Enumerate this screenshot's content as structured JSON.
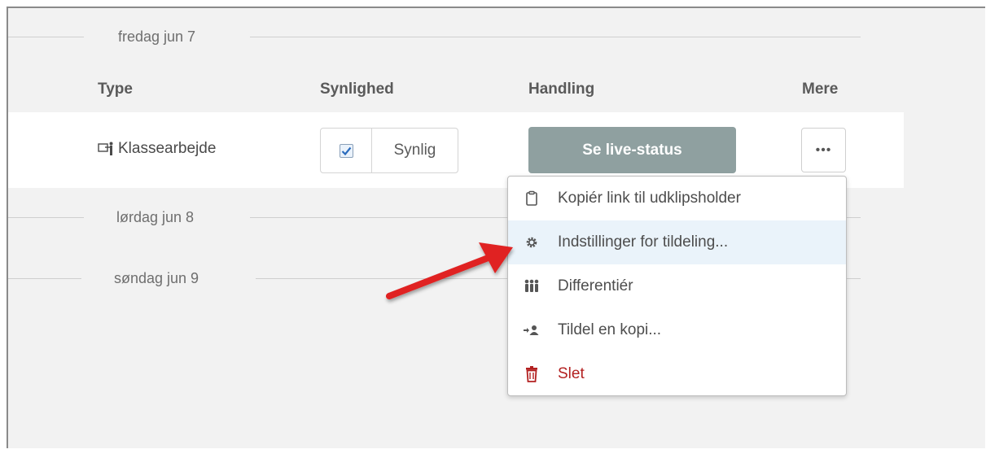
{
  "dates": {
    "friday": "fredag jun 7",
    "saturday": "lørdag jun 8",
    "sunday": "søndag jun 9"
  },
  "table": {
    "headers": {
      "type": "Type",
      "visibility": "Synlighed",
      "action": "Handling",
      "more": "Mere"
    },
    "row": {
      "type_label": "Klassearbejde",
      "type_icon": "classwork-icon",
      "visibility_checked": true,
      "visibility_label": "Synlig",
      "action_label": "Se live-status",
      "more_label": "•••"
    }
  },
  "menu": {
    "items": [
      {
        "label": "Kopiér link til udklipsholder",
        "icon": "clipboard-icon"
      },
      {
        "label": "Indstillinger for tildeling...",
        "icon": "gear-icon",
        "highlighted": true
      },
      {
        "label": "Differentiér",
        "icon": "group-icon"
      },
      {
        "label": "Tildel en kopi...",
        "icon": "assign-user-icon"
      },
      {
        "label": "Slet",
        "icon": "trash-icon",
        "danger": true
      }
    ]
  },
  "colors": {
    "accent_button": "#8fa0a0",
    "highlight": "#eaf3fa",
    "danger": "#b32020",
    "annotation_arrow": "#e02020"
  }
}
